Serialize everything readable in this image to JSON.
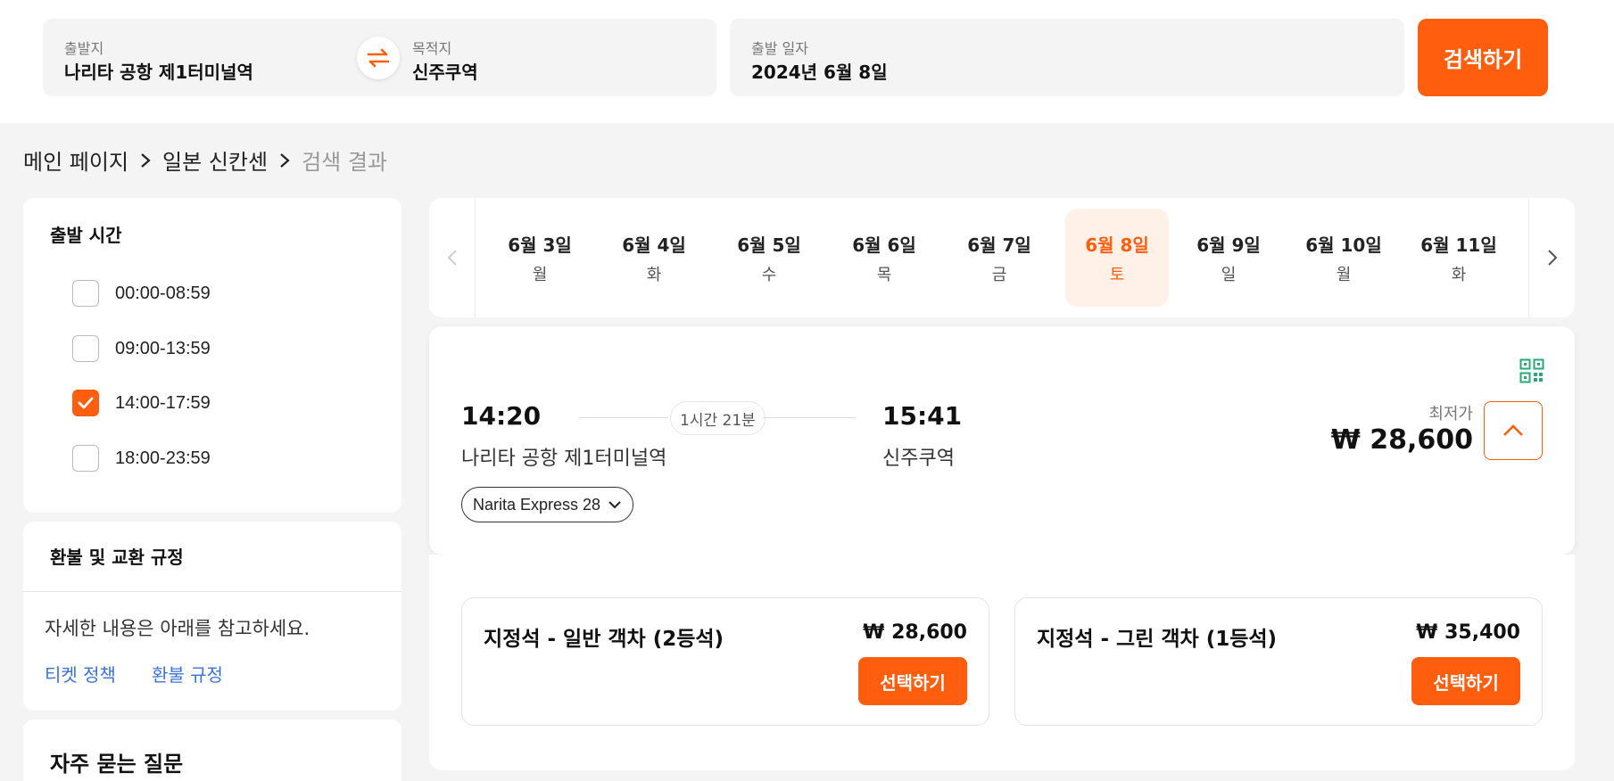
{
  "search": {
    "origin_label": "출발지",
    "origin_value": "나리타 공항 제1터미널역",
    "destination_label": "목적지",
    "destination_value": "신주쿠역",
    "date_label": "출발 일자",
    "date_value": "2024년 6월 8일",
    "search_button": "검색하기"
  },
  "breadcrumb": {
    "items": [
      "메인 페이지",
      "일본 신칸센",
      "검색 결과"
    ]
  },
  "filters": {
    "title": "출발 시간",
    "options": [
      {
        "label": "00:00-08:59",
        "checked": false
      },
      {
        "label": "09:00-13:59",
        "checked": false
      },
      {
        "label": "14:00-17:59",
        "checked": true
      },
      {
        "label": "18:00-23:59",
        "checked": false
      }
    ]
  },
  "refund": {
    "title": "환불 및 교환 규정",
    "text": "자세한 내용은 아래를 참고하세요.",
    "link1": "티켓 정책",
    "link2": "환불 규정"
  },
  "faq": {
    "title": "자주 묻는 질문"
  },
  "dates": [
    {
      "date": "6월 3일",
      "weekday": "월",
      "active": false
    },
    {
      "date": "6월 4일",
      "weekday": "화",
      "active": false
    },
    {
      "date": "6월 5일",
      "weekday": "수",
      "active": false
    },
    {
      "date": "6월 6일",
      "weekday": "목",
      "active": false
    },
    {
      "date": "6월 7일",
      "weekday": "금",
      "active": false
    },
    {
      "date": "6월 8일",
      "weekday": "토",
      "active": true
    },
    {
      "date": "6월 9일",
      "weekday": "일",
      "active": false
    },
    {
      "date": "6월 10일",
      "weekday": "월",
      "active": false
    },
    {
      "date": "6월 11일",
      "weekday": "화",
      "active": false
    }
  ],
  "train": {
    "depart_time": "14:20",
    "depart_station": "나리타 공항 제1터미널역",
    "duration": "1시간 21분",
    "arrive_time": "15:41",
    "arrive_station": "신주쿠역",
    "train_name": "Narita Express 28",
    "price_label": "최저가",
    "price": "₩ 28,600"
  },
  "seats": [
    {
      "name": "지정석 - 일반 객차 (2등석)",
      "price": "₩ 28,600",
      "button": "선택하기"
    },
    {
      "name": "지정석 - 그린 객차 (1등석)",
      "price": "₩ 35,400",
      "button": "선택하기"
    }
  ],
  "colors": {
    "accent": "#ff5e0e",
    "link": "#3a73d6"
  }
}
